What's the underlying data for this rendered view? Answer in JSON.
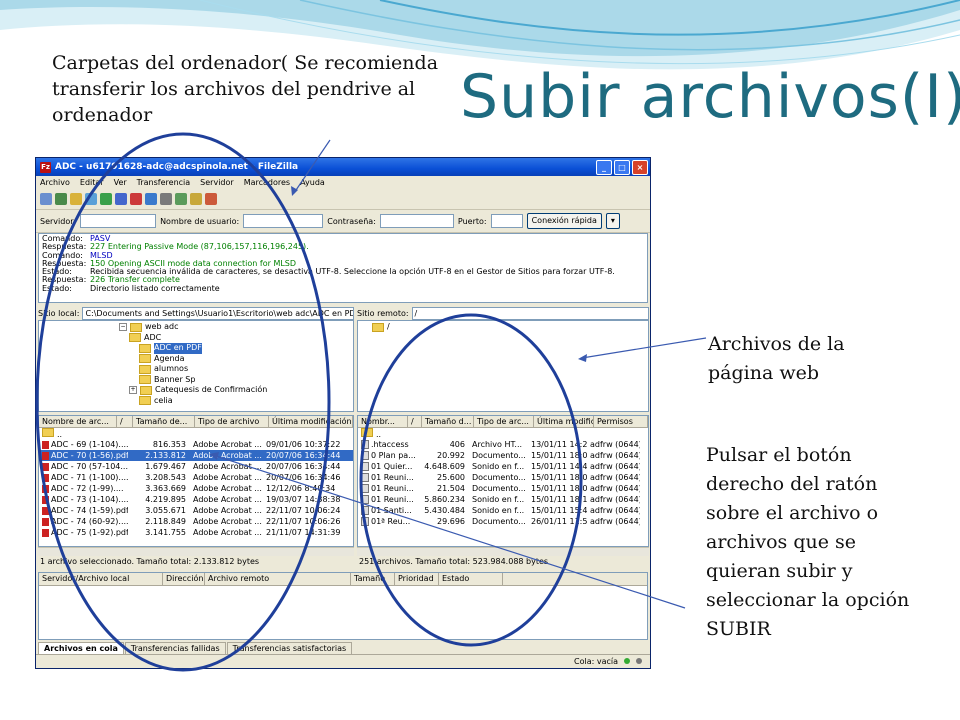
{
  "slide": {
    "title": "Subir archivos(I)",
    "note_top": "Carpetas del ordenador( Se recomienda transferir los archivos del pendrive al ordenador",
    "note_web": "Archivos de la página web",
    "note_button": "Pulsar el botón derecho del ratón sobre el archivo o archivos que se quieran subir y seleccionar la opción SUBIR",
    "colors": {
      "title": "#1e6b80",
      "wave_dark": "#6db8d8",
      "wave_light": "#bfe3ef",
      "ellipse": "#1f3f9a"
    }
  },
  "app": {
    "logo": "Fz",
    "window_title": "ADC - u61791628-adc@adcspinola.net - FileZilla",
    "window_buttons": [
      "_",
      "□",
      "×"
    ],
    "menu": [
      "Archivo",
      "Editar",
      "Ver",
      "Transferencia",
      "Servidor",
      "Marcadores",
      "Ayuda"
    ],
    "quickconnect": {
      "host_label": "Servidor:",
      "user_label": "Nombre de usuario:",
      "pass_label": "Contraseña:",
      "port_label": "Puerto:",
      "button": "Conexión rápida",
      "dropdown": "▾"
    },
    "log": [
      {
        "label": "Comando:",
        "text": "PASV",
        "color": "#0000c0"
      },
      {
        "label": "Respuesta:",
        "text": "227 Entering Passive Mode (87,106,157,116,196,245).",
        "color": "#008000"
      },
      {
        "label": "Comando:",
        "text": "MLSD",
        "color": "#0000c0"
      },
      {
        "label": "Respuesta:",
        "text": "150 Opening ASCII mode data connection for MLSD",
        "color": "#008000"
      },
      {
        "label": "Estado:",
        "text": "Recibida secuencia inválida de caracteres, se desactiva UTF-8. Seleccione la opción UTF-8 en el Gestor de Sitios para forzar UTF-8.",
        "color": "#000000"
      },
      {
        "label": "Respuesta:",
        "text": "226 Transfer complete",
        "color": "#008000"
      },
      {
        "label": "Estado:",
        "text": "Directorio listado correctamente",
        "color": "#000000"
      }
    ],
    "local": {
      "site_label": "Sitio local:",
      "site_path": "C:\\Documents and Settings\\Usuario1\\Escritorio\\web adc\\ADC en PDF\\",
      "tree": [
        "web adc",
        "ADC",
        "ADC en PDF",
        "Agenda",
        "alumnos",
        "Banner Sp",
        "Catequesis de Confirmación",
        "celia"
      ],
      "columns": [
        "Nombre de arc...",
        "/",
        "Tamaño de...",
        "Tipo de archivo",
        "Última modificación"
      ],
      "files": [
        {
          "name": "..",
          "size": "",
          "type": "",
          "date": ""
        },
        {
          "name": "ADC - 69 (1-104)....",
          "size": "816.353",
          "type": "Adobe Acrobat ...",
          "date": "09/01/06 10:37:22"
        },
        {
          "name": "ADC - 70 (1-56).pdf",
          "size": "2.133.812",
          "type": "Adobe Acrobat ...",
          "date": "20/07/06 16:34:44"
        },
        {
          "name": "ADC - 70 (57-104....",
          "size": "1.679.467",
          "type": "Adobe Acrobat ...",
          "date": "20/07/06 16:34:44"
        },
        {
          "name": "ADC - 71 (1-100)....",
          "size": "3.208.543",
          "type": "Adobe Acrobat ...",
          "date": "20/07/06 16:34:46"
        },
        {
          "name": "ADC - 72 (1-99)....",
          "size": "3.363.669",
          "type": "Adobe Acrobat ...",
          "date": "12/12/06 8:40:34"
        },
        {
          "name": "ADC - 73 (1-104)....",
          "size": "4.219.895",
          "type": "Adobe Acrobat ...",
          "date": "19/03/07 14:38:38"
        },
        {
          "name": "ADC - 74 (1-59).pdf",
          "size": "3.055.671",
          "type": "Adobe Acrobat ...",
          "date": "22/11/07 10:06:24"
        },
        {
          "name": "ADC - 74 (60-92)....",
          "size": "2.118.849",
          "type": "Adobe Acrobat ...",
          "date": "22/11/07 10:06:26"
        },
        {
          "name": "ADC - 75 (1-92).pdf",
          "size": "3.141.755",
          "type": "Adobe Acrobat ...",
          "date": "21/11/07 14:31:39"
        }
      ],
      "status": "1 archivo seleccionado. Tamaño total: 2.133.812 bytes"
    },
    "remote": {
      "site_label": "Sitio remoto:",
      "site_path": "/",
      "tree": [
        "/"
      ],
      "columns": [
        "Nombr...",
        "/",
        "Tamaño d...",
        "Tipo de arc...",
        "Última modifica...",
        "Permisos"
      ],
      "files": [
        {
          "name": "..",
          "size": "",
          "type": "",
          "date": "",
          "perm": ""
        },
        {
          "name": ".htaccess",
          "size": "406",
          "type": "Archivo HT...",
          "date": "13/01/11 14:22...",
          "perm": "adfrw (0644)"
        },
        {
          "name": "0 Plan pa...",
          "size": "20.992",
          "type": "Documento...",
          "date": "15/01/11 18:07...",
          "perm": "adfrw (0644)"
        },
        {
          "name": "01 Quier...",
          "size": "4.648.609",
          "type": "Sonido en f...",
          "date": "15/01/11 14:46...",
          "perm": "adfrw (0644)"
        },
        {
          "name": "01 Reuni...",
          "size": "25.600",
          "type": "Documento...",
          "date": "15/01/11 18:04...",
          "perm": "adfrw (0644)"
        },
        {
          "name": "01 Reuni...",
          "size": "21.504",
          "type": "Documento...",
          "date": "15/01/11 18:04...",
          "perm": "adfrw (0644)"
        },
        {
          "name": "01 Reuni...",
          "size": "5.860.234",
          "type": "Sonido en f...",
          "date": "15/01/11 18:11...",
          "perm": "adfrw (0644)"
        },
        {
          "name": "01 Santi...",
          "size": "5.430.484",
          "type": "Sonido en f...",
          "date": "15/01/11 15:40...",
          "perm": "adfrw (0644)"
        },
        {
          "name": "01ª Reu...",
          "size": "29.696",
          "type": "Documento...",
          "date": "26/01/11 11:57...",
          "perm": "adfrw (0644)"
        }
      ],
      "status": "251 archivos. Tamaño total: 523.984.088 bytes"
    },
    "queue": {
      "columns": [
        "Servidor/Archivo local",
        "Dirección",
        "Archivo remoto",
        "Tamaño",
        "Prioridad",
        "Estado"
      ]
    },
    "tabs": [
      "Archivos en cola",
      "Transferencias fallidas",
      "Transferencias satisfactorias"
    ],
    "statusbar": {
      "queue": "Cola: vacía"
    }
  }
}
